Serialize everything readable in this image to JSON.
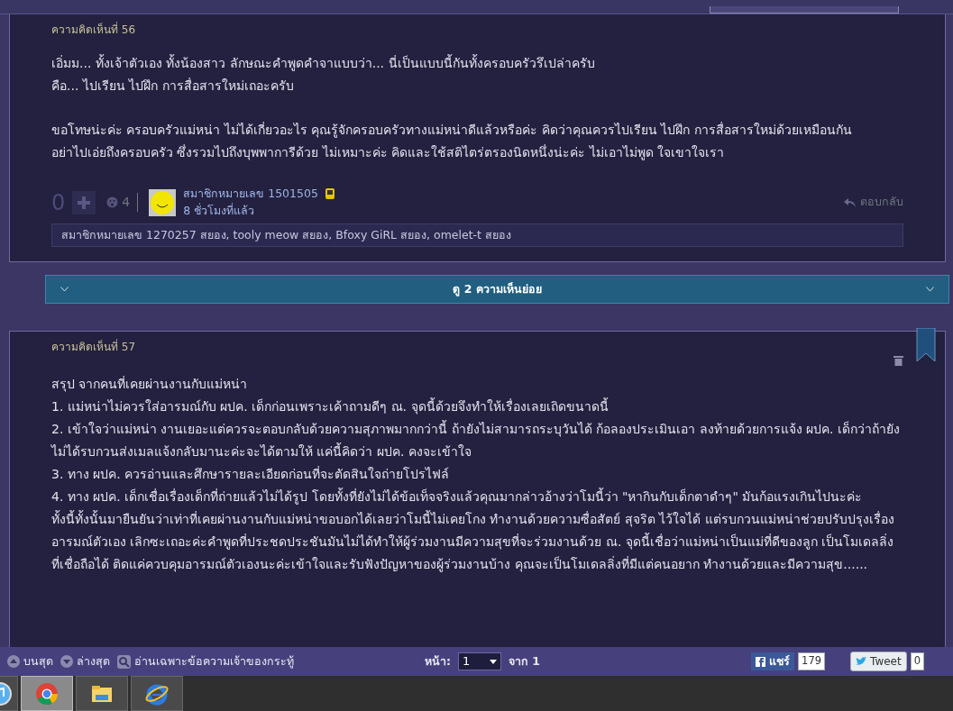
{
  "comments": [
    {
      "label": "ความคิดเห็นที่ 56",
      "paragraphs": [
        [
          "เอิ่มม...  ทั้งเจ้าตัวเอง  ทั้งน้องสาว  ลักษณะคำพูดคำจาแบบว่า...  นี่เป็นแบบนี้กันทั้งครอบครัวรึเปล่าครับ",
          "คือ...  ไปเรียน  ไปฝึก  การสื่อสารใหม่เถอะครับ"
        ],
        [
          "ขอโทษน่ะค่ะ ครอบครัวแม่หน่า ไม่ได้เกี่ยวอะไร คุณรู้จักครอบครัวทางแม่หน่าดีแล้วหรือค่ะ  คิดว่าคุณควรไปเรียน ไปฝึก การสื่อสารใหม่ด้วยเหมือนกัน",
          "อย่าไปเอ่ยถึงครอบครัว ซึ่งรวมไปถึงบุพพาการีด้วย ไม่เหมาะค่ะ  คิดและใช้สติไตร่ตรองนิดหนึ่งน่ะค่ะ  ไม่เอาไม่พูด  ใจเขาใจเรา"
        ]
      ],
      "votes": "0",
      "emotions": "4",
      "member": "สมาชิกหมายเลข 1501505",
      "time": "8 ชั่วโมงที่แล้ว",
      "reply": "ตอบกลับ",
      "reactions": "สมาชิกหมายเลข 1270257 สยอง, tooly meow สยอง, Bfoxy GiRL สยอง, omelet-t สยอง"
    },
    {
      "label": "ความคิดเห็นที่ 57",
      "lines": [
        "สรุป จากคนที่เคยผ่านงานกับแม่หน่า",
        "1. แม่หน่าไม่ควรใส่อารมณ์กับ ผปค. เด็กก่อนเพราะเค้าถามดีๆ ณ. จุดนี้ด้วยจึงทำให้เรื่องเลยเถิดขนาดนี้",
        "2. เข้าใจว่าแม่หน่า งานเยอะแต่ควรจะตอบกลับด้วยความสุภาพมากกว่านี้ ถ้ายังไม่สามารถระบุวันได้ ก้อลองประเมินเอา ลงท้ายด้วยการแจ้ง ผปค. เด็กว่าถ้ายังไม่ได้รบกวนส่งเมลแจ้งกลับมานะค่ะจะได้ตามให้ แค่นี้คิดว่า ผปค. คงจะเข้าใจ",
        "3. ทาง ผปค. ควรอ่านและศึกษารายละเอียดก่อนที่จะตัดสินใจถ่ายโปรไฟล์",
        "4. ทาง ผปค. เด็กเชื่อเรื่องเด็กที่ถ่ายแล้วไม่ได้รูป โดยทั้งที่ยังไม่ได้ข้อเท็จจริงแล้วคุณมากล่าวอ้างว่าโมนี้ว่า \"หากินกับเด็กตาดำๆ\" มันก้อแรงเกินไปนะค่ะ",
        "ทั้งนี้ทั้งนั้นมายืนยันว่าเท่าที่เคยผ่านงานกับแม่หน่าขอบอกได้เลยว่าโมนี้ไม่เคยโกง ทำงานด้วยความซื่อสัตย์ สุจริต ไว้ใจได้ แต่รบกวนแม่หน่าช่วยปรับปรุงเรื่องอารมณ์ตัวเอง เลิกซะเถอะค่ะคำพูดที่ประชดประชันมันไม่ได้ทำให้ผู้ร่วมงานมีความสุขที่จะร่วมงานด้วย ณ. จุดนี้เชื่อว่าแม่หน่าเป็นแม่ที่ดีของลูก เป็นโมเดลลิ่งที่เชื่อถือได้ ติดแค่ควบคุมอารมณ์ตัวเองนะค่ะเข้าใจและรับฟังปัญหาของผู้ร่วมงานบ้าง คุณจะเป็นโมเดลลิ่งที่มีแต่คนอยาก ทำงานด้วยและมีความสุข......"
      ]
    }
  ],
  "expand_bar": "ดู 2 ความเห็นย่อย",
  "footer": {
    "top": "บนสุด",
    "bottom": "ล่างสุด",
    "owner_only": "อ่านเฉพาะข้อความเจ้าของกระทู้",
    "page_label": "หน้า:",
    "page": "1",
    "page_total": "จาก 1",
    "share": "แชร์",
    "share_count": "179",
    "tweet": "Tweet",
    "tweet_count": "0"
  },
  "taskbar": [
    {
      "kind": "itunes",
      "selected": false
    },
    {
      "kind": "chrome",
      "selected": true
    },
    {
      "kind": "explorer",
      "selected": false
    },
    {
      "kind": "ie",
      "selected": false
    }
  ]
}
